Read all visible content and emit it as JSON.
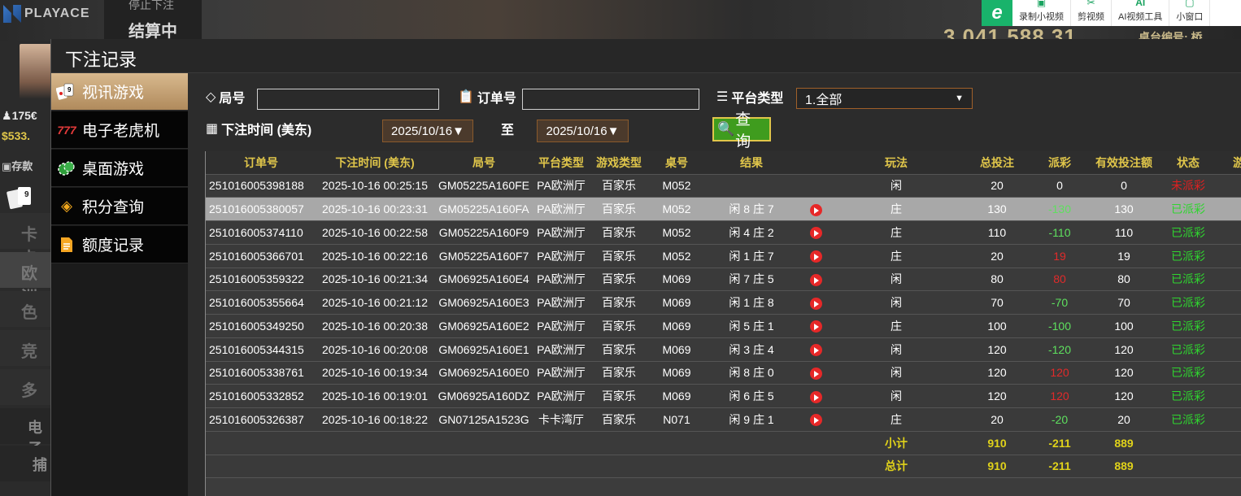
{
  "background": {
    "brand": "PLAYACE",
    "stop_line1": "停止下注",
    "stop_line2": "结算中",
    "jackpot": "3,041,588.31",
    "table_id": "桌台编号: 桥",
    "balance1": "175€",
    "balance2": "533.",
    "deposit": "存款",
    "side_tabs": [
      "卡卡",
      "欧洲",
      "色",
      "竞",
      "多",
      "电子",
      "捕"
    ]
  },
  "browser_toolbar": {
    "logo": "e",
    "items": [
      {
        "icon": "▣",
        "label": "录制小视频"
      },
      {
        "icon": "✂",
        "label": "剪视频"
      },
      {
        "icon": "AI",
        "label": "AI视频工具"
      },
      {
        "icon": "▢",
        "label": "小窗口"
      }
    ]
  },
  "modal": {
    "title": "下注记录",
    "menu": [
      {
        "label": "视讯游戏",
        "active": true,
        "icon": "cards"
      },
      {
        "label": "电子老虎机",
        "active": false,
        "icon": "777"
      },
      {
        "label": "桌面游戏",
        "active": false,
        "icon": "chips"
      },
      {
        "label": "积分查询",
        "active": false,
        "icon": "diamond"
      },
      {
        "label": "额度记录",
        "active": false,
        "icon": "document"
      }
    ],
    "filters": {
      "round_label": "局号",
      "round_value": "",
      "order_label": "订单号",
      "order_value": "",
      "platform_label": "平台类型",
      "platform_value": "1.全部",
      "time_label": "下注时间 (美东)",
      "date_from": "2025/10/16▼",
      "to_label": "至",
      "date_to": "2025/10/16▼",
      "query_label": "查询"
    },
    "table": {
      "headers": [
        "订单号",
        "下注时间 (美东)",
        "局号",
        "平台类型",
        "游戏类型",
        "桌号",
        "结果",
        "",
        "玩法",
        "总投注",
        "派彩",
        "有效投注额",
        "状态",
        "游"
      ],
      "rows": [
        [
          "251016005398188",
          "2025-10-16 00:25:15",
          "GM05225A160FE",
          "PA欧洲厅",
          "百家乐",
          "M052",
          "",
          "",
          "闲",
          "20",
          "0",
          "0",
          "未派彩"
        ],
        [
          "251016005380057",
          "2025-10-16 00:23:31",
          "GM05225A160FA",
          "PA欧洲厅",
          "百家乐",
          "M052",
          "闲 8 庄 7",
          "play",
          "庄",
          "130",
          "-130",
          "130",
          "已派彩"
        ],
        [
          "251016005374110",
          "2025-10-16 00:22:58",
          "GM05225A160F9",
          "PA欧洲厅",
          "百家乐",
          "M052",
          "闲 4 庄 2",
          "play",
          "庄",
          "110",
          "-110",
          "110",
          "已派彩"
        ],
        [
          "251016005366701",
          "2025-10-16 00:22:16",
          "GM05225A160F7",
          "PA欧洲厅",
          "百家乐",
          "M052",
          "闲 1 庄 7",
          "play",
          "庄",
          "20",
          "19",
          "19",
          "已派彩"
        ],
        [
          "251016005359322",
          "2025-10-16 00:21:34",
          "GM06925A160E4",
          "PA欧洲厅",
          "百家乐",
          "M069",
          "闲 7 庄 5",
          "play",
          "闲",
          "80",
          "80",
          "80",
          "已派彩"
        ],
        [
          "251016005355664",
          "2025-10-16 00:21:12",
          "GM06925A160E3",
          "PA欧洲厅",
          "百家乐",
          "M069",
          "闲 1 庄 8",
          "play",
          "闲",
          "70",
          "-70",
          "70",
          "已派彩"
        ],
        [
          "251016005349250",
          "2025-10-16 00:20:38",
          "GM06925A160E2",
          "PA欧洲厅",
          "百家乐",
          "M069",
          "闲 5 庄 1",
          "play",
          "庄",
          "100",
          "-100",
          "100",
          "已派彩"
        ],
        [
          "251016005344315",
          "2025-10-16 00:20:08",
          "GM06925A160E1",
          "PA欧洲厅",
          "百家乐",
          "M069",
          "闲 3 庄 4",
          "play",
          "闲",
          "120",
          "-120",
          "120",
          "已派彩"
        ],
        [
          "251016005338761",
          "2025-10-16 00:19:34",
          "GM06925A160E0",
          "PA欧洲厅",
          "百家乐",
          "M069",
          "闲 8 庄 0",
          "play",
          "闲",
          "120",
          "120",
          "120",
          "已派彩"
        ],
        [
          "251016005332852",
          "2025-10-16 00:19:01",
          "GM06925A160DZ",
          "PA欧洲厅",
          "百家乐",
          "M069",
          "闲 6 庄 5",
          "play",
          "闲",
          "120",
          "120",
          "120",
          "已派彩"
        ],
        [
          "251016005326387",
          "2025-10-16 00:18:22",
          "GN07125A1523G",
          "卡卡湾厅",
          "百家乐",
          "N071",
          "闲 9 庄 1",
          "play",
          "庄",
          "20",
          "-20",
          "20",
          "已派彩"
        ]
      ],
      "subtotal": {
        "label": "小计",
        "total_bet": "910",
        "payout": "-211",
        "valid_bet": "889"
      },
      "total": {
        "label": "总计",
        "total_bet": "910",
        "payout": "-211",
        "valid_bet": "889"
      }
    }
  },
  "colors": {
    "accent_gold": "#e0c64a",
    "menu_active": "#c9a575",
    "positive_payout": "#5ee05e",
    "negative_payout": "#e12a2a",
    "status_paid": "#2fd52f",
    "status_unpaid": "#e02020",
    "query_button": "#3f9c1e"
  }
}
